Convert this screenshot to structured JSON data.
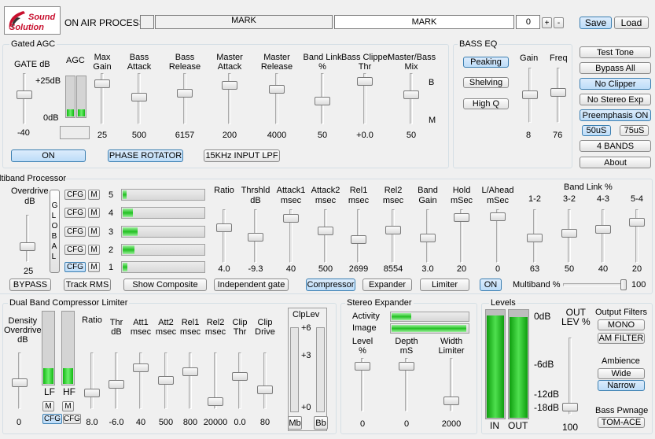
{
  "header": {
    "logo_text_1": "Sound",
    "logo_text_2": "Solution",
    "on_air_label": "ON AIR PROCESS:",
    "preset_left": "MARK",
    "preset_right": "MARK",
    "preset_number": "0",
    "plus": "+",
    "minus": "-",
    "save": "Save",
    "load": "Load"
  },
  "gated_agc": {
    "title": "Gated AGC",
    "gate_label": "GATE dB",
    "agc_label": "AGC",
    "agc_top": "+25dB",
    "agc_bottom": "0dB",
    "gate_value": "-40",
    "columns": [
      {
        "label": "Max\nGain",
        "value": "25"
      },
      {
        "label": "Bass\nAttack",
        "value": "500"
      },
      {
        "label": "Bass\nRelease",
        "value": "6157"
      },
      {
        "label": "Master\nAttack",
        "value": "200"
      },
      {
        "label": "Master\nRelease",
        "value": "4000"
      },
      {
        "label": "Band Link\n%",
        "value": "50"
      },
      {
        "label": "Bass Clipper\nThr",
        "value": "+0.0"
      },
      {
        "label": "Master/Bass\nMix",
        "value": "50"
      }
    ],
    "mix_b": "B",
    "mix_m": "M",
    "on": "ON",
    "phase_rotator": "PHASE ROTATOR",
    "lpf": "15KHz INPUT LPF"
  },
  "bass_eq": {
    "title": "BASS EQ",
    "peaking": "Peaking",
    "shelving": "Shelving",
    "high_q": "High Q",
    "gain_label": "Gain",
    "freq_label": "Freq",
    "gain_value": "8",
    "freq_value": "76"
  },
  "side_buttons": {
    "test_tone": "Test Tone",
    "bypass_all": "Bypass All",
    "no_clipper": "No Clipper",
    "no_stereo_exp": "No Stereo Exp",
    "preemphasis": "Preemphasis ON",
    "us50": "50uS",
    "us75": "75uS",
    "bands": "4 BANDS",
    "about": "About"
  },
  "multiband": {
    "title": "ltiband Processor",
    "overdrive_label": "Overdrive\ndB",
    "overdrive_value": "25",
    "global": "G\nL\nO\nB\nA\nL",
    "cfg": "CFG",
    "m": "M",
    "bands": [
      {
        "num": "5",
        "level": 0.05
      },
      {
        "num": "4",
        "level": 0.12
      },
      {
        "num": "3",
        "level": 0.18
      },
      {
        "num": "2",
        "level": 0.14
      },
      {
        "num": "1",
        "level": 0.06
      }
    ],
    "columns": [
      {
        "label": "Ratio",
        "value": "4.0"
      },
      {
        "label": "Thrshld\ndB",
        "value": "-9.3"
      },
      {
        "label": "Attack1\nmsec",
        "value": "40"
      },
      {
        "label": "Attack2\nmsec",
        "value": "500"
      },
      {
        "label": "Rel1\nmsec",
        "value": "2699"
      },
      {
        "label": "Rel2\nmsec",
        "value": "8554"
      },
      {
        "label": "Band\nGain",
        "value": "3.0"
      },
      {
        "label": "Hold\nmSec",
        "value": "20"
      },
      {
        "label": "L/Ahead\nmSec",
        "value": "0"
      }
    ],
    "band_link_title": "Band Link %",
    "link_columns": [
      {
        "label": "1-2",
        "value": "63"
      },
      {
        "label": "3-2",
        "value": "50"
      },
      {
        "label": "4-3",
        "value": "40"
      },
      {
        "label": "5-4",
        "value": "20"
      }
    ],
    "bypass": "BYPASS",
    "track_rms": "Track RMS",
    "show_composite": "Show Composite",
    "independent_gate": "Independent gate",
    "compressor": "Compressor",
    "expander": "Expander",
    "limiter": "Limiter",
    "on": "ON",
    "multiband_pct_label": "Multiband %",
    "multiband_pct_value": "100"
  },
  "dual_band": {
    "title": "Dual Band Compressor Limiter",
    "density_label": "Density\nOverdrive\ndB",
    "density_value": "0",
    "lf": "LF",
    "hf": "HF",
    "lf_level": 0.22,
    "hf_level": 0.22,
    "m": "M",
    "cfg": "CFG",
    "columns": [
      {
        "label": "Ratio",
        "value": "8.0"
      },
      {
        "label": "Thr\ndB",
        "value": "-6.0"
      },
      {
        "label": "Att1\nmsec",
        "value": "40"
      },
      {
        "label": "Att2\nmsec",
        "value": "500"
      },
      {
        "label": "Rel1\nmsec",
        "value": "800"
      },
      {
        "label": "Rel2\nmsec",
        "value": "20000"
      },
      {
        "label": "Clip\nThr",
        "value": "0.0"
      },
      {
        "label": "Clip\nDrive",
        "value": "80"
      }
    ],
    "cliplev_title": "ClpLev",
    "cliplev_top": "+6",
    "cliplev_mid": "+3",
    "cliplev_bottom": "+0",
    "mb": "Mb",
    "bb": "Bb"
  },
  "stereo_expander": {
    "title": "Stereo Expander",
    "activity": "Activity",
    "image": "Image",
    "activity_level": 0.25,
    "image_level": 0.98,
    "columns": [
      {
        "label": "Level\n%",
        "value": "0"
      },
      {
        "label": "Depth\nmS",
        "value": "0"
      },
      {
        "label": "Width\nLimiter",
        "value": "2000"
      }
    ]
  },
  "levels": {
    "title": "Levels",
    "scale_0": "0dB",
    "scale_6": "-6dB",
    "scale_12": "-12dB",
    "scale_18": "-18dB",
    "in": "IN",
    "out": "OUT",
    "in_level": 0.95,
    "out_level": 0.94,
    "out_lev_label": "OUT\nLEV %",
    "out_lev_value": "100",
    "output_filters": "Output Filters",
    "mono": "MONO",
    "am_filter": "AM FILTER",
    "ambience": "Ambience",
    "wide": "Wide",
    "narrow": "Narrow",
    "bass_pwnage": "Bass Pwnage",
    "tom_ace": "TOM-ACE"
  },
  "colors": {
    "active_button": "#bcdcf8",
    "meter_green": "#22c022",
    "logo_red": "#c8102e"
  }
}
